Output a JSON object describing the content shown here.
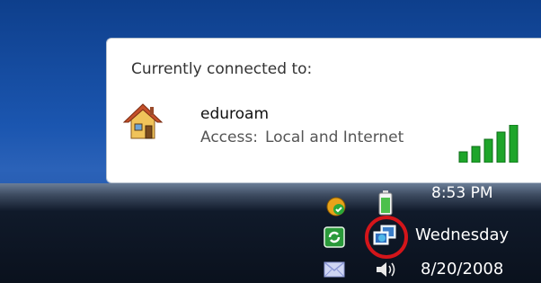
{
  "popup": {
    "heading": "Currently connected to:",
    "network_name": "eduroam",
    "access_label": "Access:",
    "access_value": "Local and Internet",
    "signal_bars_filled": 5,
    "signal_bars_total": 5
  },
  "tray": {
    "icons": [
      "shield-update-icon",
      "battery-icon",
      "sync-icon",
      "network-icon",
      "mail-icon",
      "volume-icon"
    ]
  },
  "clock": {
    "time": "8:53 PM",
    "day": "Wednesday",
    "date": "8/20/2008"
  },
  "colors": {
    "desktop": "#1b56b0",
    "signal_green": "#1ea52a",
    "highlight_ring": "#d3151a"
  }
}
